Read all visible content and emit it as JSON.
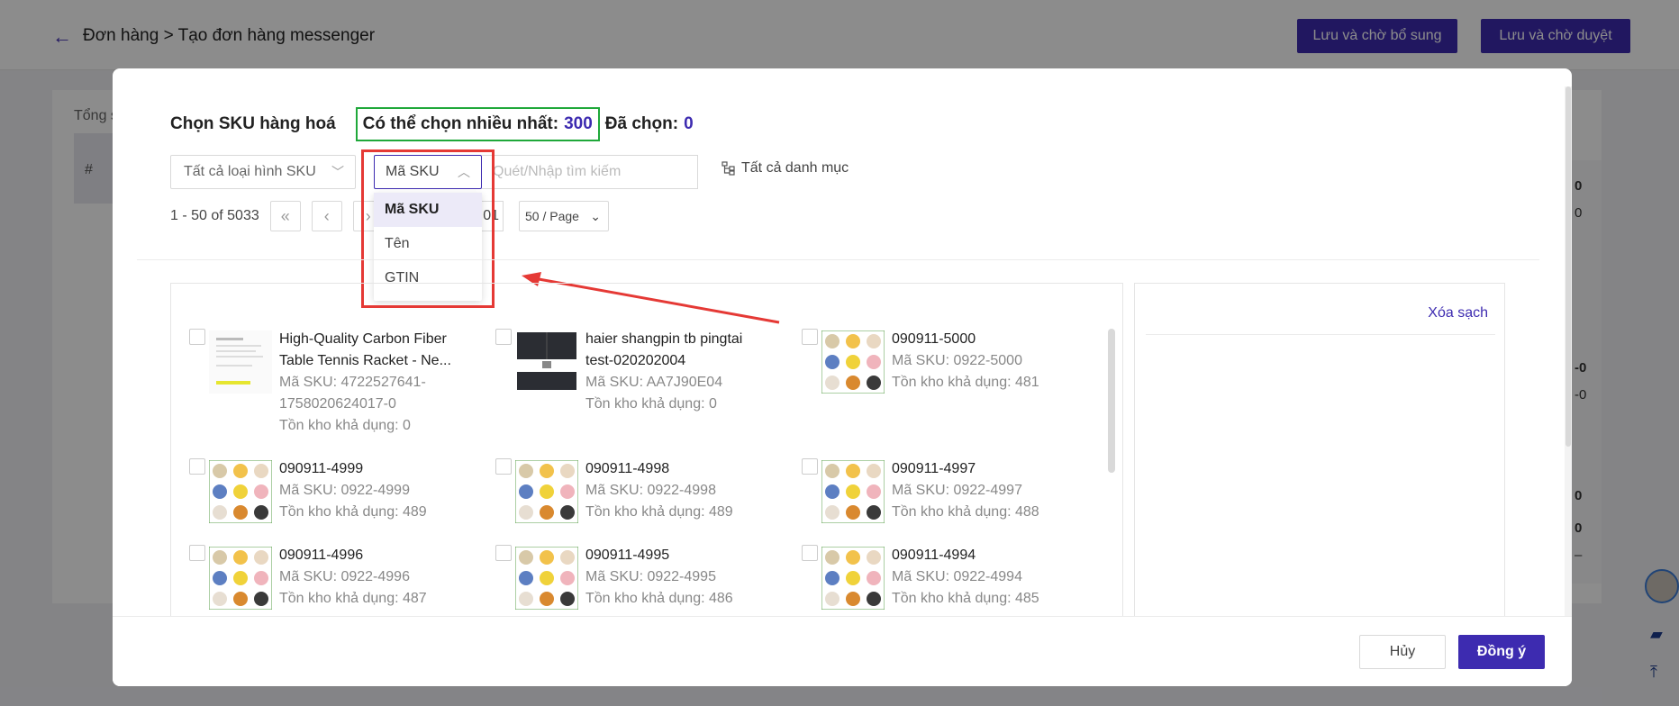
{
  "header": {
    "breadcrumb": "Đơn hàng > Tạo đơn hàng messenger",
    "save_supplement": "Lưu và chờ bổ sung",
    "save_review": "Lưu và chờ duyệt"
  },
  "background": {
    "total_label": "Tổng s",
    "hash": "#",
    "right_values": [
      "0",
      "0",
      "-0",
      "-0",
      "-0",
      "0",
      "0",
      "–"
    ]
  },
  "modal": {
    "title": "Chọn SKU hàng hoá",
    "max_label": "Có thể chọn nhiều nhất:",
    "max_value": "300",
    "chosen_label": "Đã chọn:",
    "chosen_value": "0",
    "sku_type_select": "Tất cả loại hình SKU",
    "search_field_select": "Mã SKU",
    "search_placeholder": "Quét/Nhập tìm kiếm",
    "category": "Tất cả danh mục",
    "dropdown_options": [
      "Mã SKU",
      "Tên",
      "GTIN"
    ],
    "pager": {
      "range": "1 - 50 of 5033",
      "page_input": "01",
      "page_size": "50 / Page"
    },
    "products": [
      {
        "name": "High-Quality Carbon Fiber Table Tennis Racket - Ne...",
        "sku": "Mã SKU: 4722527641-1758020624017-0",
        "stock": "Tồn kho khả dụng: 0"
      },
      {
        "name": "haier shangpin tb pingtai test-020202004",
        "sku": "Mã SKU: AA7J90E04",
        "stock": "Tồn kho khả dụng: 0"
      },
      {
        "name": "090911-5000",
        "sku": "Mã SKU: 0922-5000",
        "stock": "Tồn kho khả dụng: 481"
      },
      {
        "name": "090911-4999",
        "sku": "Mã SKU: 0922-4999",
        "stock": "Tồn kho khả dụng: 489"
      },
      {
        "name": "090911-4998",
        "sku": "Mã SKU: 0922-4998",
        "stock": "Tồn kho khả dụng: 489"
      },
      {
        "name": "090911-4997",
        "sku": "Mã SKU: 0922-4997",
        "stock": "Tồn kho khả dụng: 488"
      },
      {
        "name": "090911-4996",
        "sku": "Mã SKU: 0922-4996",
        "stock": "Tồn kho khả dụng: 487"
      },
      {
        "name": "090911-4995",
        "sku": "Mã SKU: 0922-4995",
        "stock": "Tồn kho khả dụng: 486"
      },
      {
        "name": "090911-4994",
        "sku": "Mã SKU: 0922-4994",
        "stock": "Tồn kho khả dụng: 485"
      }
    ],
    "clear_all": "Xóa sạch",
    "cancel": "Hủy",
    "confirm": "Đồng ý"
  },
  "colors": {
    "primary": "#3d2bb0",
    "highlight_green": "#1fa83a",
    "highlight_red": "#e53935"
  }
}
